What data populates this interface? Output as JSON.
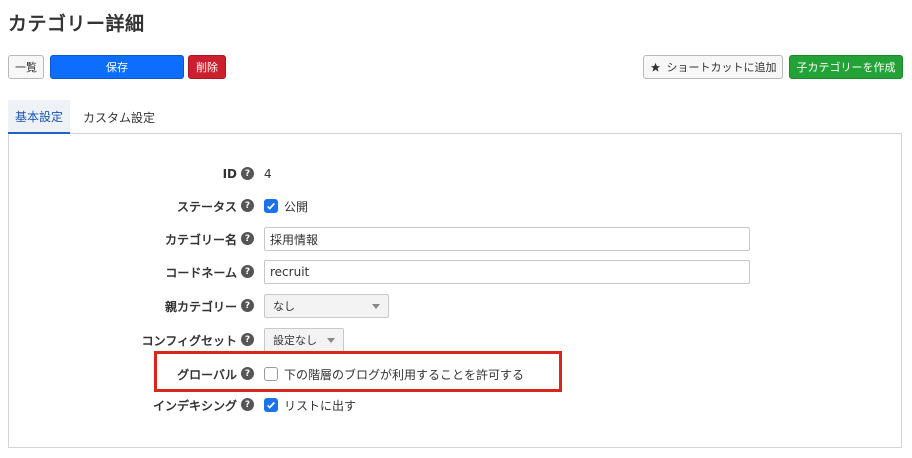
{
  "page": {
    "title": "カテゴリー詳細"
  },
  "toolbar": {
    "list_label": "一覧",
    "save_label": "保存",
    "delete_label": "削除",
    "shortcut_label": "ショートカットに追加",
    "create_child_label": "子カテゴリーを作成"
  },
  "tabs": [
    {
      "label": "基本設定",
      "active": true
    },
    {
      "label": "カスタム設定",
      "active": false
    }
  ],
  "form": {
    "id": {
      "label": "ID",
      "value": "4"
    },
    "status": {
      "label": "ステータス",
      "option": "公開",
      "checked": true
    },
    "category_name": {
      "label": "カテゴリー名",
      "value": "採用情報"
    },
    "code_name": {
      "label": "コードネーム",
      "value": "recruit"
    },
    "parent_category": {
      "label": "親カテゴリー",
      "selected": "なし"
    },
    "config_set": {
      "label": "コンフィグセット",
      "selected": "設定なし"
    },
    "global": {
      "label": "グローバル",
      "option": "下の階層のブログが利用することを許可する",
      "checked": false
    },
    "indexing": {
      "label": "インデキシング",
      "option": "リストに出す",
      "checked": true
    }
  },
  "help_glyph": "?",
  "colors": {
    "primary": "#0d6efd",
    "danger": "#cc1f2e",
    "success": "#23a337",
    "highlight": "#d9261c",
    "check": "#1a73e8"
  },
  "icons": {
    "shortcut": "star-icon",
    "help": "help-icon",
    "check": "checkmark-icon",
    "dropdown": "caret-down-icon"
  }
}
